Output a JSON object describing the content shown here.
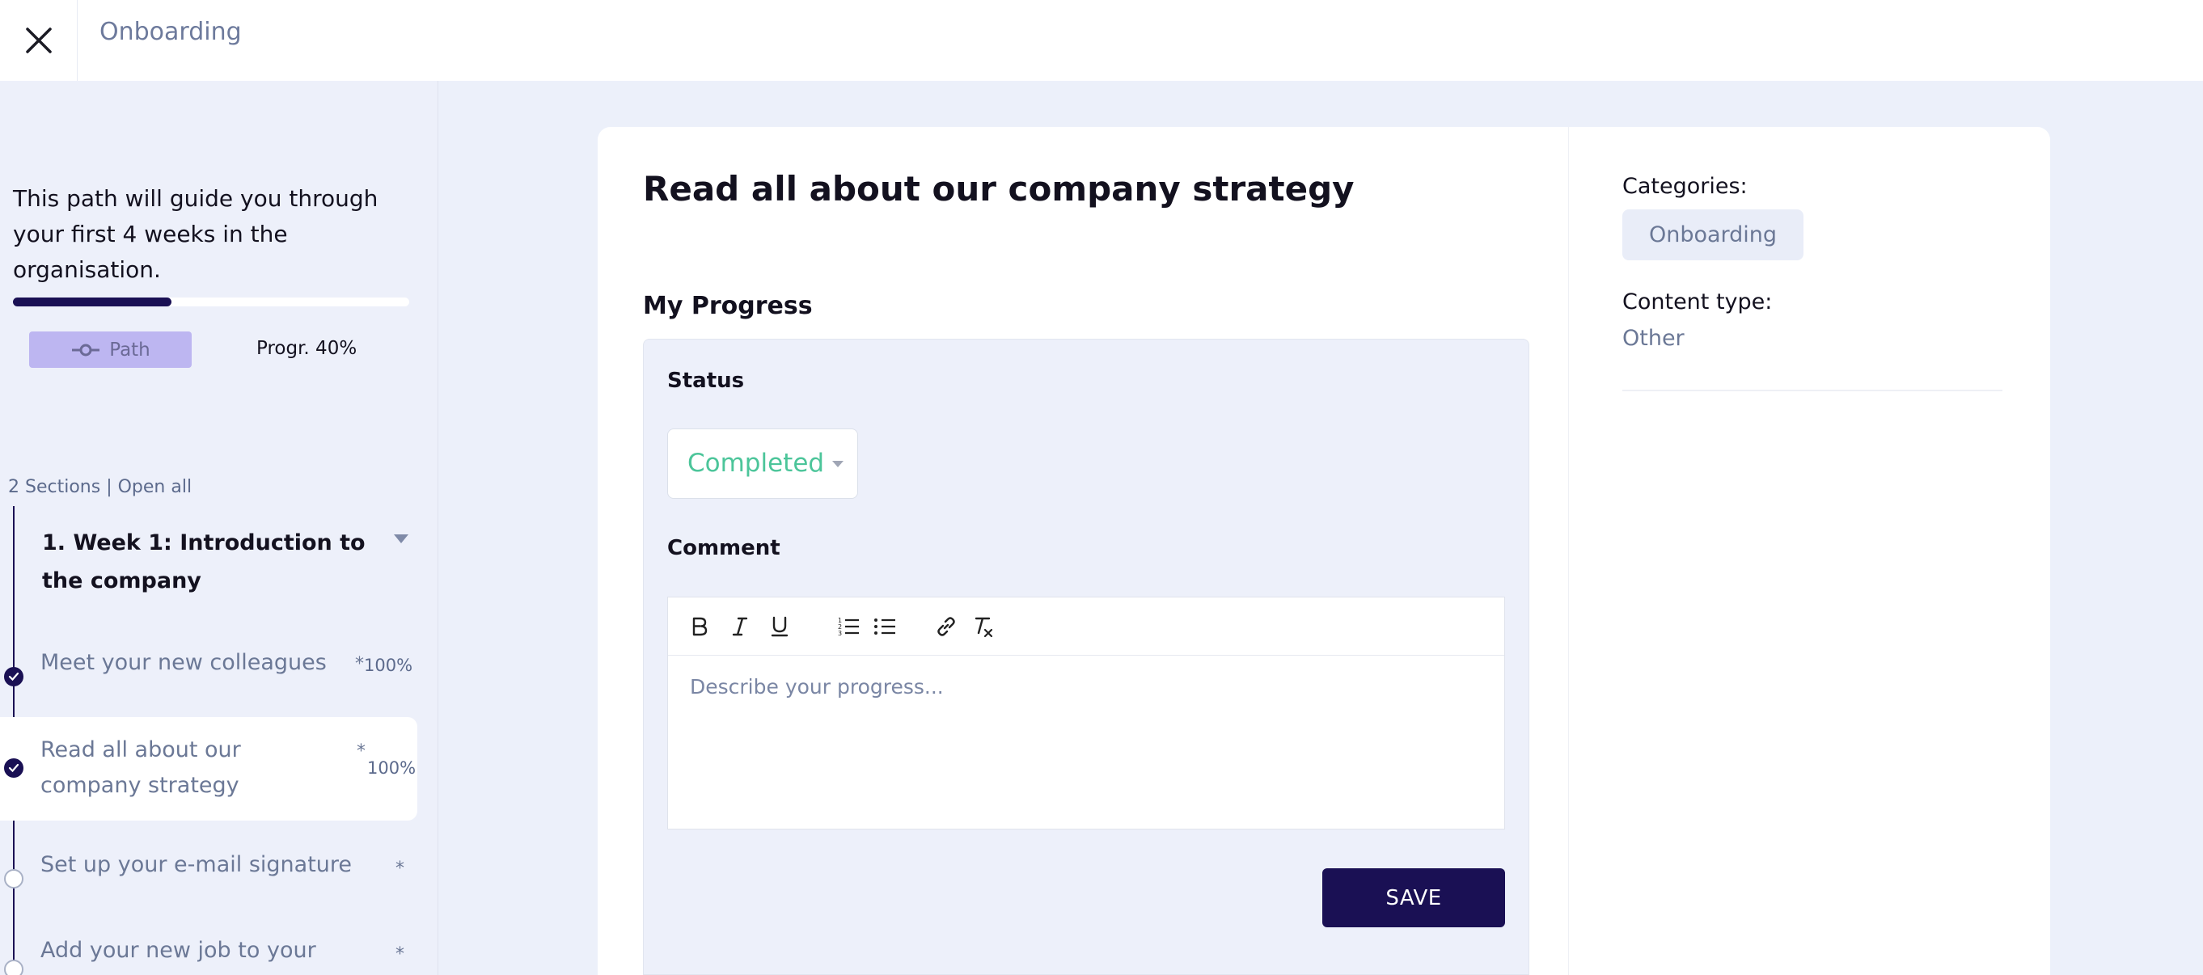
{
  "header": {
    "title": "Onboarding",
    "close_icon": "close-icon"
  },
  "sidebar": {
    "description": "This path will guide you through your first 4 weeks in the organisation.",
    "progress_value": 0.4,
    "path_chip_label": "Path",
    "path_chip_icon": "path-icon",
    "progress_label": "Progr. 40%",
    "sections_count": "2 Sections",
    "separator": " | ",
    "open_all_label": "Open all",
    "section": {
      "title": "1. Week 1: Introduction to the company",
      "expanded": true
    },
    "steps": [
      {
        "label": "Meet your new colleagues",
        "star": "*",
        "percent": "100%",
        "done": true
      },
      {
        "label": "Read all about our company strategy",
        "star": "*",
        "percent": "100%",
        "done": true,
        "active": true
      },
      {
        "label": "Set up your e-mail signature",
        "star": "*",
        "percent": "",
        "done": false
      },
      {
        "label": "Add your new job to your",
        "star": "*",
        "percent": "",
        "done": false
      }
    ]
  },
  "main": {
    "title": "Read all about our company strategy",
    "my_progress_heading": "My Progress",
    "status_label": "Status",
    "status_value": "Completed",
    "comment_label": "Comment",
    "toolbar": [
      "bold-icon",
      "italic-icon",
      "underline-icon",
      "ordered-list-icon",
      "bullet-list-icon",
      "link-icon",
      "clear-format-icon"
    ],
    "comment_placeholder": "Describe your progress...",
    "save_label": "SAVE"
  },
  "details": {
    "categories_label": "Categories:",
    "category": "Onboarding",
    "content_type_label": "Content type:",
    "content_type": "Other"
  },
  "colors": {
    "accent": "#1a1054",
    "completed": "#4cc59a",
    "chip": "#bdb6f1",
    "background": "#ecf0fa"
  }
}
